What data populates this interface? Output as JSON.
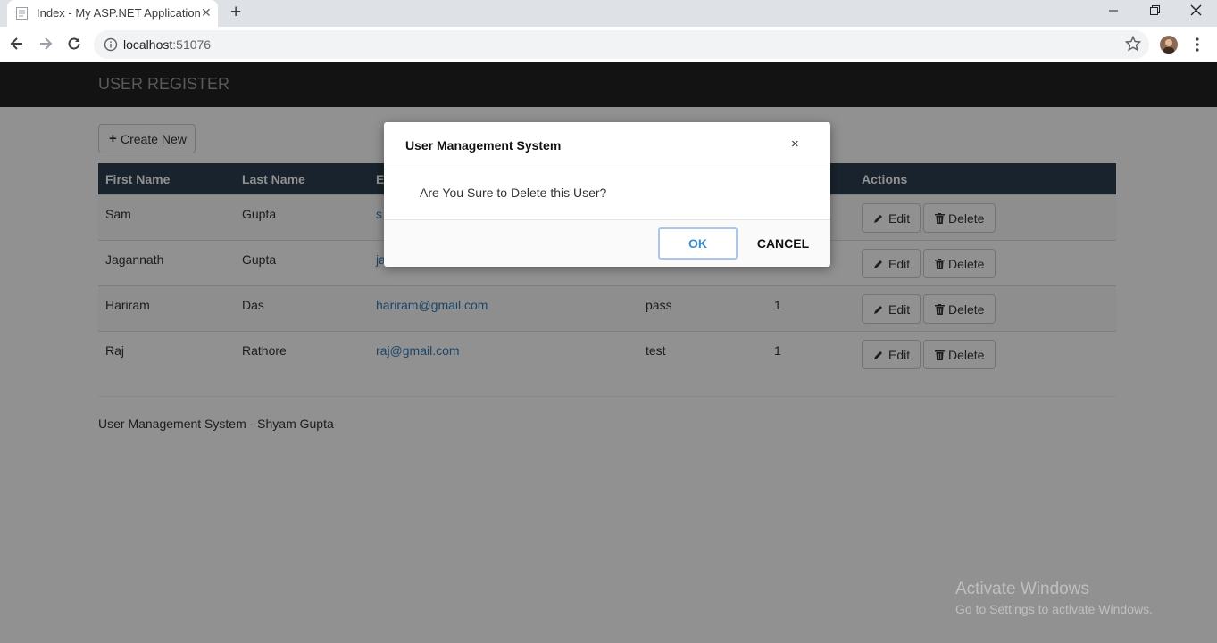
{
  "browser": {
    "tab_title": "Index - My ASP.NET Application",
    "url_host": "localhost",
    "url_port": ":51076"
  },
  "app": {
    "brand": "USER REGISTER",
    "create_label": "Create New",
    "columns": [
      "First Name",
      "Last Name",
      "E",
      "Actions"
    ],
    "rows": [
      {
        "first": "Sam",
        "last": "Gupta",
        "email": "s",
        "password": "",
        "status": ""
      },
      {
        "first": "Jagannath",
        "last": "Gupta",
        "email": "ja",
        "password": "",
        "status": ""
      },
      {
        "first": "Hariram",
        "last": "Das",
        "email": "hariram@gmail.com",
        "password": "pass",
        "status": "1"
      },
      {
        "first": "Raj",
        "last": "Rathore",
        "email": "raj@gmail.com",
        "password": "test",
        "status": "1"
      }
    ],
    "edit_label": "Edit",
    "delete_label": "Delete",
    "footer": "User Management System - Shyam Gupta"
  },
  "modal": {
    "title": "User Management System",
    "close": "×",
    "message": "Are You Sure to Delete this User?",
    "ok_label": "OK",
    "cancel_label": "CANCEL"
  },
  "watermark": {
    "line1": "Activate Windows",
    "line2": "Go to Settings to activate Windows."
  },
  "colors": {
    "navbar": "#222222",
    "table_header": "#2d3e50",
    "link": "#337ab7",
    "ok_text": "#3a8fcf"
  }
}
